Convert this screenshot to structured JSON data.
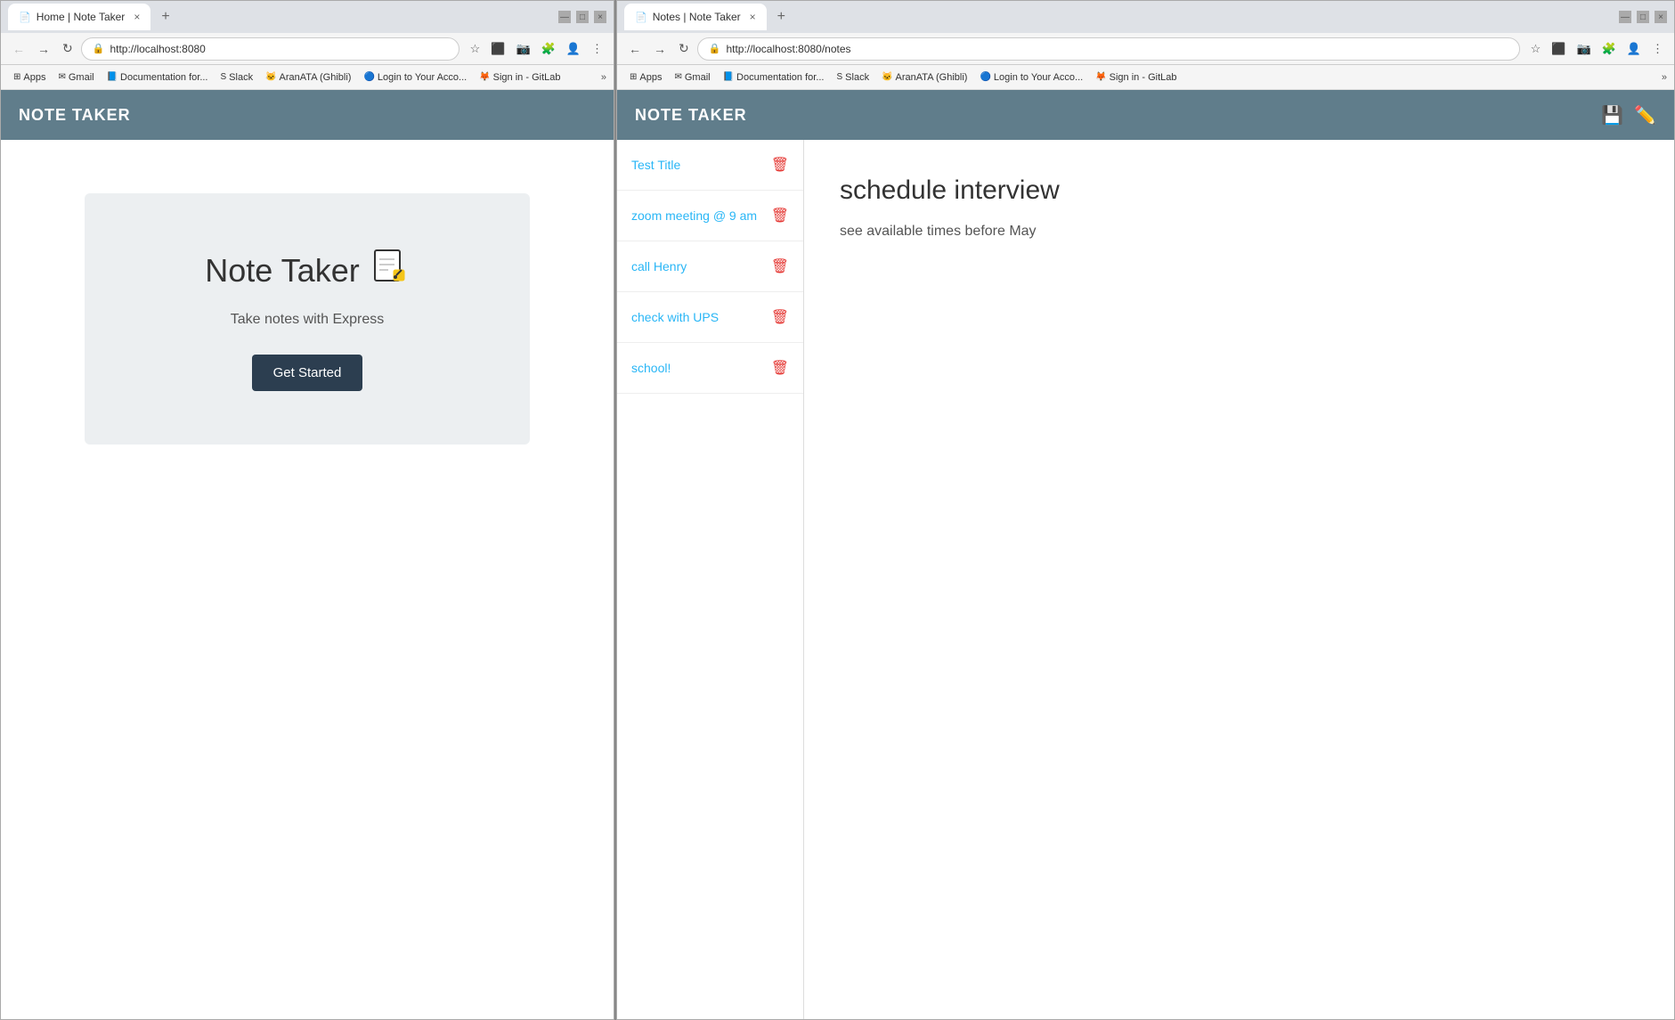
{
  "left_window": {
    "tab_title": "Home | Note Taker",
    "tab_close": "×",
    "tab_new": "+",
    "win_controls": [
      "—",
      "□",
      "×"
    ],
    "url": "http://localhost:8080",
    "nav_buttons": [
      "←",
      "→",
      "↻"
    ],
    "bookmarks": [
      {
        "label": "Apps",
        "icon": "⊞"
      },
      {
        "label": "Gmail",
        "icon": "✉"
      },
      {
        "label": "Documentation for...",
        "icon": "📘"
      },
      {
        "label": "Slack",
        "icon": "S"
      },
      {
        "label": "AranATA (Ghibli)",
        "icon": "🐱"
      },
      {
        "label": "Login to Your Acco...",
        "icon": "🔵"
      },
      {
        "label": "Sign in - GitLab",
        "icon": "🦊"
      }
    ],
    "bookmarks_more": "»",
    "header_title": "NOTE TAKER",
    "hero": {
      "app_name": "Note Taker",
      "subtitle": "Take notes with Express",
      "button_label": "Get Started"
    }
  },
  "right_window": {
    "tab_title": "Notes | Note Taker",
    "tab_close": "×",
    "tab_new": "+",
    "win_controls": [
      "—",
      "□",
      "×"
    ],
    "url": "http://localhost:8080/notes",
    "nav_buttons": [
      "←",
      "→",
      "↻"
    ],
    "bookmarks": [
      {
        "label": "Apps",
        "icon": "⊞"
      },
      {
        "label": "Gmail",
        "icon": "✉"
      },
      {
        "label": "Documentation for...",
        "icon": "📘"
      },
      {
        "label": "Slack",
        "icon": "S"
      },
      {
        "label": "AranATA (Ghibli)",
        "icon": "🐱"
      },
      {
        "label": "Login to Your Acco...",
        "icon": "🔵"
      },
      {
        "label": "Sign in - GitLab",
        "icon": "🦊"
      }
    ],
    "bookmarks_more": "»",
    "header_title": "NOTE TAKER",
    "header_save_icon": "💾",
    "header_edit_icon": "✏️",
    "notes": [
      {
        "title": "Test Title"
      },
      {
        "title": "zoom meeting @ 9 am"
      },
      {
        "title": "call Henry"
      },
      {
        "title": "check with UPS"
      },
      {
        "title": "school!"
      }
    ],
    "active_note": {
      "title": "schedule interview",
      "body": "see available times before May"
    }
  },
  "icons": {
    "trash": "🗑",
    "note_emoji": "📝"
  }
}
